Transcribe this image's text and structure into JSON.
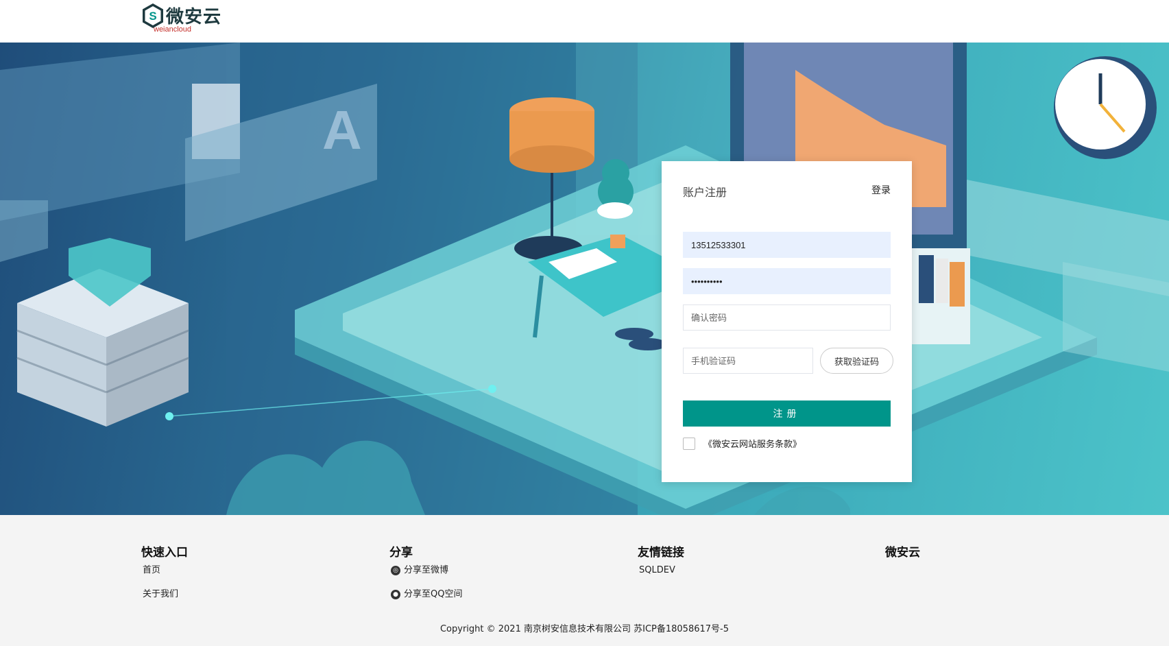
{
  "header": {
    "logo_text": "微安云",
    "logo_sub": "weiancloud"
  },
  "register": {
    "title": "账户注册",
    "login_link": "登录",
    "phone_value": "13512533301",
    "password_value": "••••••••••",
    "confirm_placeholder": "确认密码",
    "sms_placeholder": "手机验证码",
    "get_code_label": "获取验证码",
    "submit_label": "注册",
    "terms_label": "《微安云网站服务条款》"
  },
  "footer": {
    "quick": {
      "title": "快速入口",
      "links": [
        "首页",
        "关于我们"
      ]
    },
    "share": {
      "title": "分享",
      "links": [
        "分享至微博",
        "分享至QQ空间"
      ]
    },
    "friends": {
      "title": "友情链接",
      "links": [
        "SQLDEV"
      ]
    },
    "brand": {
      "title": "微安云"
    },
    "copyright": "Copyright © 2021 南京树安信息技术有限公司   苏ICP备18058617号-5"
  },
  "colors": {
    "primary": "#00958a",
    "input_filled": "#e8f0fe",
    "footer_bg": "#f4f4f4"
  }
}
